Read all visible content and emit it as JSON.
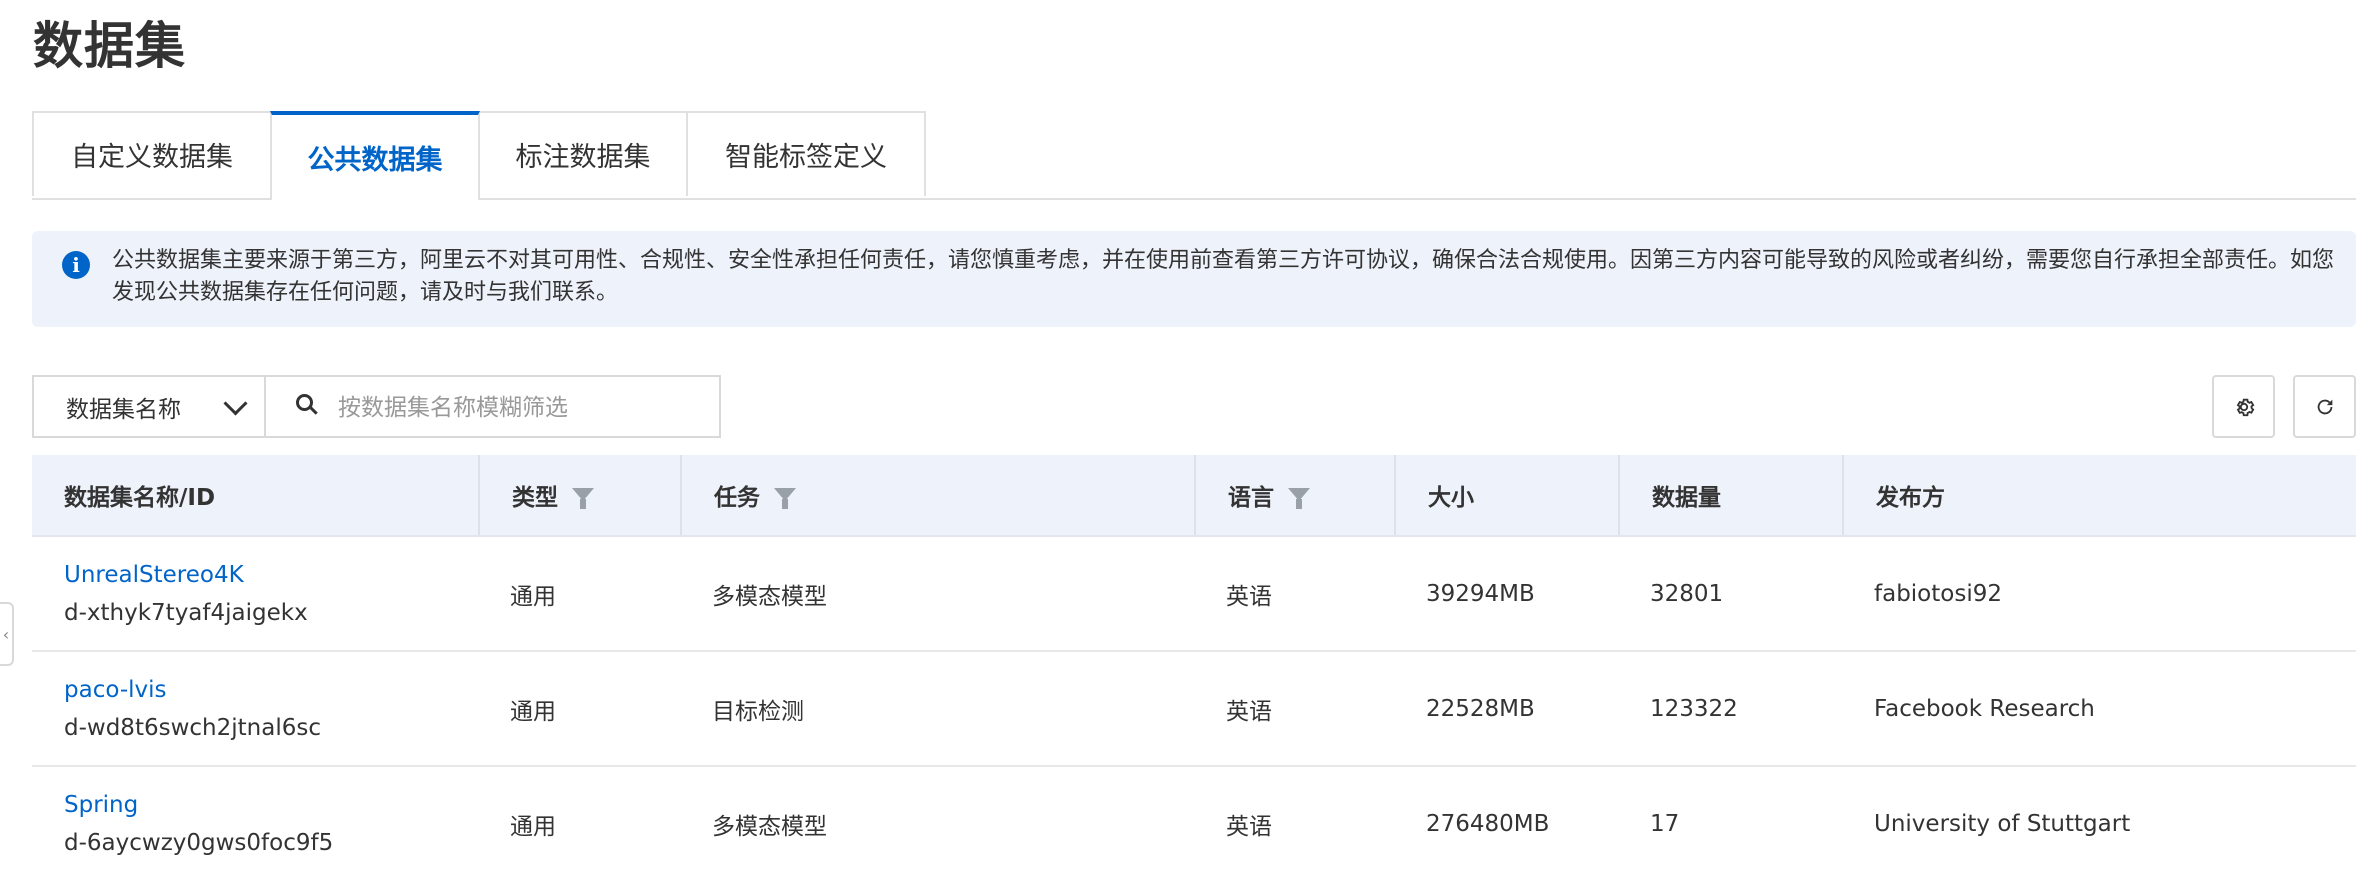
{
  "page": {
    "title": "数据集"
  },
  "tabs": [
    {
      "label": "自定义数据集",
      "active": false
    },
    {
      "label": "公共数据集",
      "active": true
    },
    {
      "label": "标注数据集",
      "active": false
    },
    {
      "label": "智能标签定义",
      "active": false
    }
  ],
  "notice": {
    "icon": "info-icon",
    "text": "公共数据集主要来源于第三方，阿里云不对其可用性、合规性、安全性承担任何责任，请您慎重考虑，并在使用前查看第三方许可协议，确保合法合规使用。因第三方内容可能导致的风险或者纠纷，需要您自行承担全部责任。如您发现公共数据集存在任何问题，请及时与我们联系。"
  },
  "filter": {
    "field_label": "数据集名称",
    "search_placeholder": "按数据集名称模糊筛选"
  },
  "toolbar": {
    "settings_icon": "gear-icon",
    "refresh_icon": "refresh-icon"
  },
  "table": {
    "columns": [
      {
        "label": "数据集名称/ID",
        "filterable": false
      },
      {
        "label": "类型",
        "filterable": true
      },
      {
        "label": "任务",
        "filterable": true
      },
      {
        "label": "语言",
        "filterable": true
      },
      {
        "label": "大小",
        "filterable": false
      },
      {
        "label": "数据量",
        "filterable": false
      },
      {
        "label": "发布方",
        "filterable": false
      }
    ],
    "rows": [
      {
        "name": "UnrealStereo4K",
        "id": "d-xthyk7tyaf4jaigekx",
        "type": "通用",
        "task": "多模态模型",
        "language": "英语",
        "size": "39294MB",
        "count": "32801",
        "publisher": "fabiotosi92"
      },
      {
        "name": "paco-lvis",
        "id": "d-wd8t6swch2jtnal6sc",
        "type": "通用",
        "task": "目标检测",
        "language": "英语",
        "size": "22528MB",
        "count": "123322",
        "publisher": "Facebook Research"
      },
      {
        "name": "Spring",
        "id": "d-6aycwzy0gws0foc9f5",
        "type": "通用",
        "task": "多模态模型",
        "language": "英语",
        "size": "276480MB",
        "count": "17",
        "publisher": "University of Stuttgart"
      }
    ]
  },
  "colors": {
    "accent": "#0064c8",
    "header_bg": "#eef2fa",
    "notice_bg": "#eef2fa"
  }
}
